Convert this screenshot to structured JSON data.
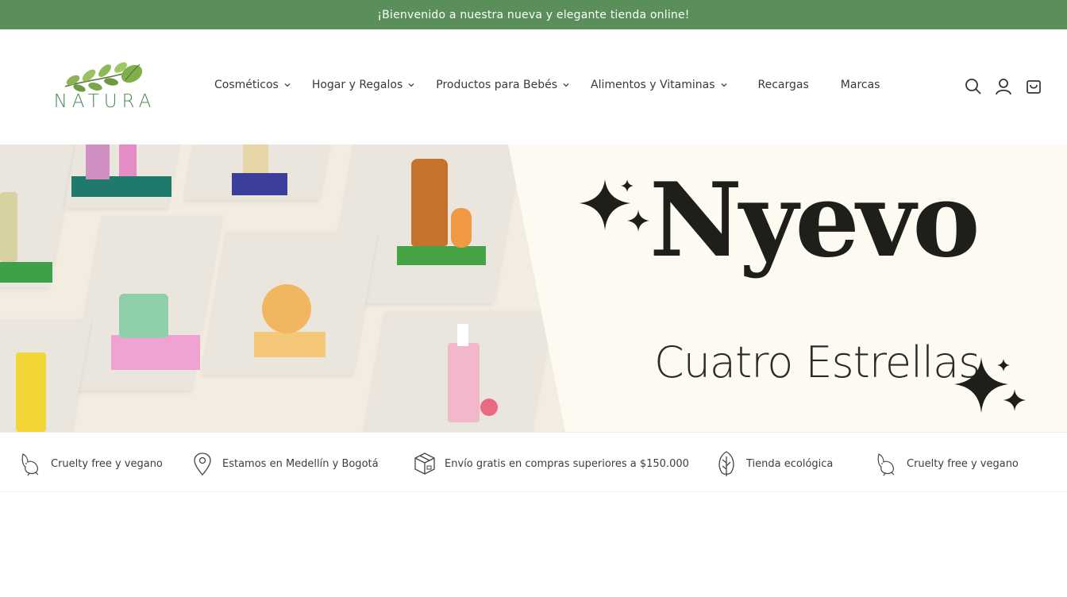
{
  "announcement": {
    "text": "¡Bienvenido a nuestra nueva y elegante tienda online!"
  },
  "brand": {
    "name": "NATURA",
    "color": "#4f8a57"
  },
  "nav": {
    "items": [
      {
        "label": "Cosméticos",
        "dropdown": true
      },
      {
        "label": "Hogar y Regalos",
        "dropdown": true
      },
      {
        "label": "Productos para Bebés",
        "dropdown": true
      },
      {
        "label": "Alimentos y Vitaminas",
        "dropdown": true
      },
      {
        "label": "Recargas",
        "dropdown": false
      },
      {
        "label": "Marcas",
        "dropdown": false
      }
    ]
  },
  "header_icons": [
    "search-icon",
    "account-icon",
    "cart-icon"
  ],
  "banner": {
    "headline": "Nyevo",
    "subline": "Cuatro Estrellas"
  },
  "features": [
    {
      "icon": "rabbit-icon",
      "text": "Cruelty free y vegano"
    },
    {
      "icon": "location-pin-icon",
      "text": "Estamos en Medellín y Bogotá"
    },
    {
      "icon": "box-icon",
      "text": "Envío gratis en compras superiores a $150.000"
    },
    {
      "icon": "leaf-icon",
      "text": "Tienda ecológica"
    },
    {
      "icon": "rabbit-icon",
      "text": "Cruelty free y vegano"
    }
  ],
  "colors": {
    "announcement_bg": "#5a8f5c",
    "banner_bg": "#fdfbf1",
    "text_dark": "#1e1e1b"
  }
}
